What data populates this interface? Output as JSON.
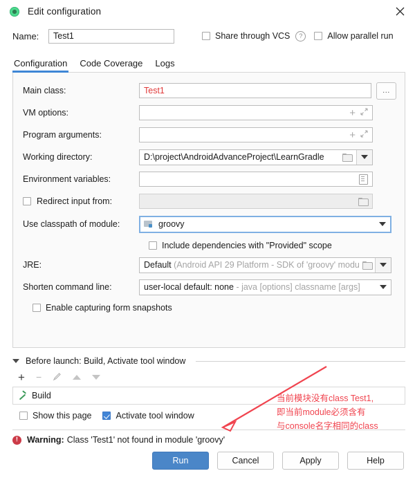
{
  "window": {
    "title": "Edit configuration",
    "app_icon": "groovy-run-icon",
    "close_icon": "close-icon"
  },
  "name_row": {
    "label": "Name:",
    "value": "Test1",
    "share_vcs": {
      "label": "Share through VCS",
      "checked": false
    },
    "help_icon": "?",
    "allow_parallel": {
      "label": "Allow parallel run",
      "checked": false
    }
  },
  "tabs": [
    {
      "label": "Configuration",
      "active": true
    },
    {
      "label": "Code Coverage",
      "active": false
    },
    {
      "label": "Logs",
      "active": false
    }
  ],
  "form": {
    "main_class": {
      "label": "Main class:",
      "value": "Test1",
      "error": true,
      "browse_label": "..."
    },
    "vm_options": {
      "label": "VM options:",
      "value": "",
      "icons": [
        "plus-icon",
        "expand-icon"
      ]
    },
    "program_arguments": {
      "label": "Program arguments:",
      "value": "",
      "icons": [
        "plus-icon",
        "expand-icon"
      ]
    },
    "working_directory": {
      "label": "Working directory:",
      "value": "D:\\project\\AndroidAdvanceProject\\LearnGradle",
      "icons": [
        "folder-icon",
        "chevron-down-icon"
      ]
    },
    "environment_variables": {
      "label": "Environment variables:",
      "value": "",
      "icons": [
        "list-icon"
      ]
    },
    "redirect_input": {
      "label": "Redirect input from:",
      "checked": false,
      "value": "",
      "icons": [
        "folder-icon"
      ]
    },
    "use_classpath": {
      "label": "Use classpath of module:",
      "value": "groovy",
      "module_icon": "module-icon",
      "focused": true
    },
    "include_provided": {
      "label": "Include dependencies with \"Provided\" scope",
      "checked": false
    },
    "jre": {
      "label": "JRE:",
      "value": "Default",
      "hint": "(Android API 29 Platform - SDK of 'groovy' modu",
      "icons": [
        "folder-icon",
        "chevron-down-icon"
      ]
    },
    "shorten_command_line": {
      "label": "Shorten command line:",
      "value": "user-local default: none",
      "hint": "- java [options] classname [args]",
      "icons": [
        "chevron-down-icon"
      ]
    },
    "enable_snapshots": {
      "label": "Enable capturing form snapshots",
      "checked": false
    }
  },
  "before_launch": {
    "header": "Before launch: Build, Activate tool window",
    "toolbar": [
      "add-icon",
      "remove-icon",
      "edit-icon",
      "move-up-icon",
      "move-down-icon"
    ],
    "items": [
      {
        "label": "Build",
        "icon": "hammer-icon"
      }
    ],
    "show_this_page": {
      "label": "Show this page",
      "checked": false
    },
    "activate_tool_window": {
      "label": "Activate tool window",
      "checked": true
    }
  },
  "warning": {
    "icon": "error-icon",
    "prefix": "Warning:",
    "message": "Class 'Test1' not found in module 'groovy'"
  },
  "buttons": {
    "run": "Run",
    "cancel": "Cancel",
    "apply": "Apply",
    "help": "Help"
  },
  "annotation": {
    "color": "#f0444f",
    "line1": "当前模块没有class Test1,",
    "line2": "即当前module必须含有",
    "line3": "与console名字相同的class"
  },
  "colors": {
    "accent_blue": "#4a86c8",
    "tab_underline": "#3e86d6",
    "error_red": "#e03a3a",
    "warning_red": "#cc3b48",
    "annotation_red": "#f0444f"
  }
}
